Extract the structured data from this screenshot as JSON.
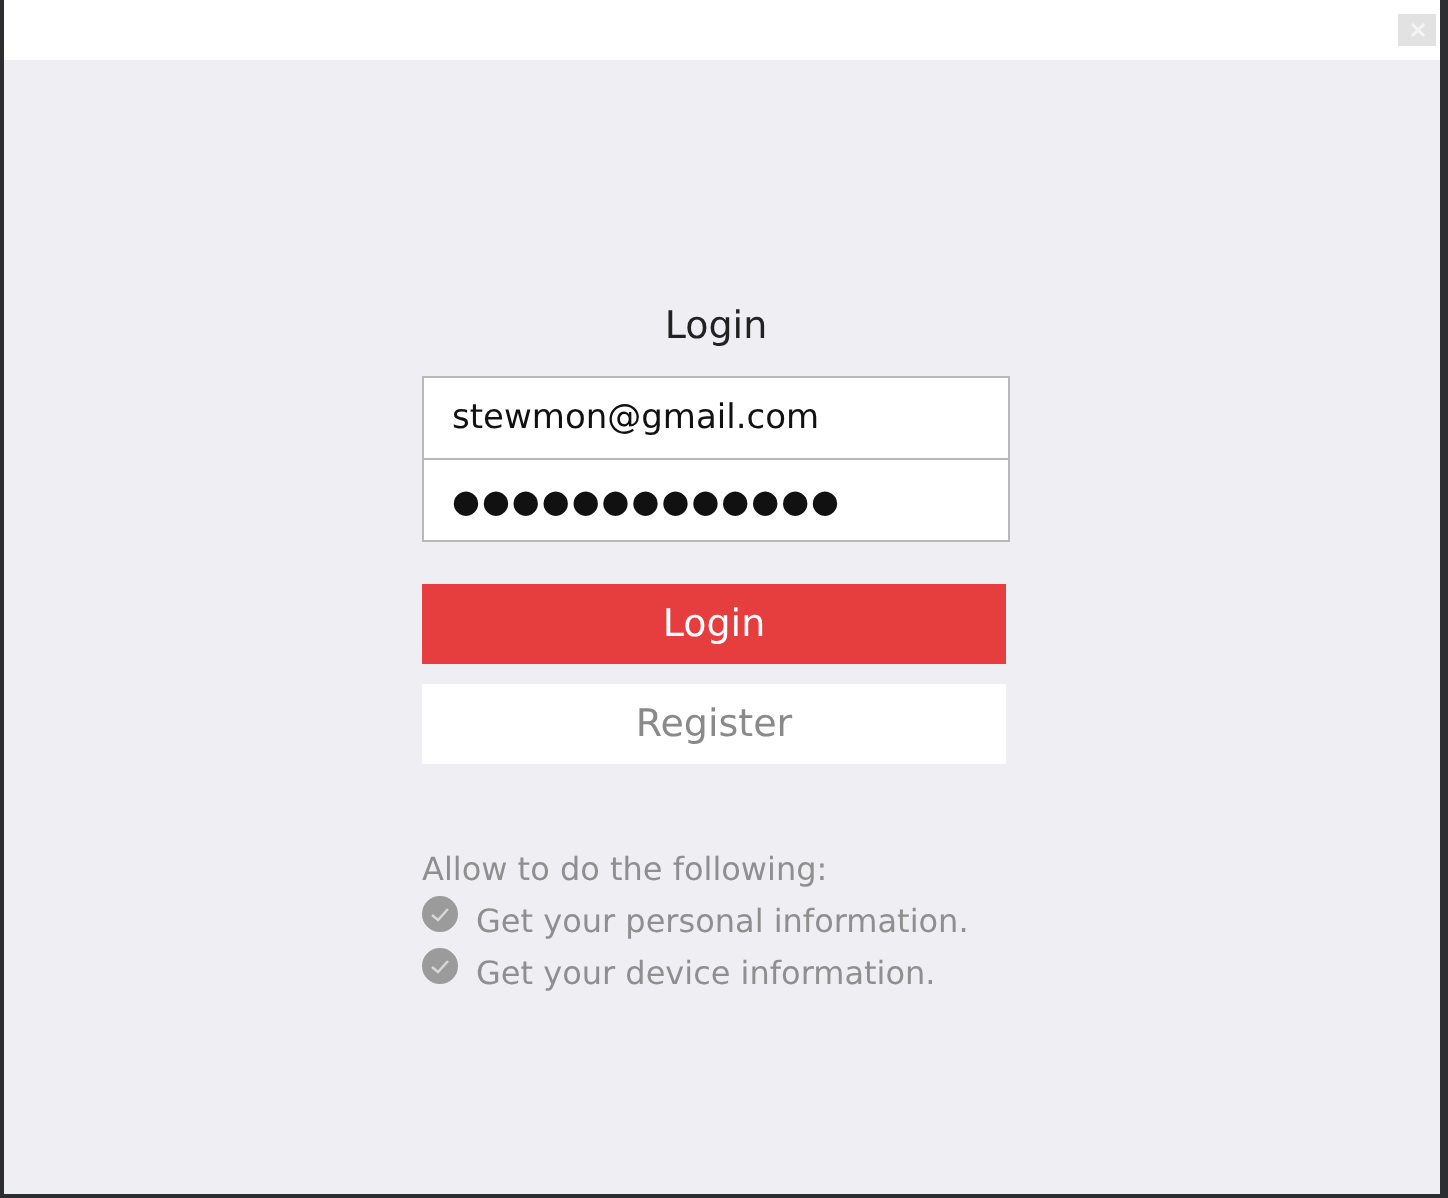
{
  "title": "Login",
  "email": {
    "value": "stewmon@gmail.com"
  },
  "password": {
    "value": "●●●●●●●●●●●●●"
  },
  "buttons": [
    {
      "kind": "primary",
      "label": "Login"
    },
    {
      "kind": "secondary",
      "label": "Register"
    }
  ],
  "permissions": {
    "heading": "Allow to do the following:",
    "items": [
      {
        "label": "Get your personal information.",
        "checked": true
      },
      {
        "label": "Get your device information.",
        "checked": true
      }
    ]
  }
}
